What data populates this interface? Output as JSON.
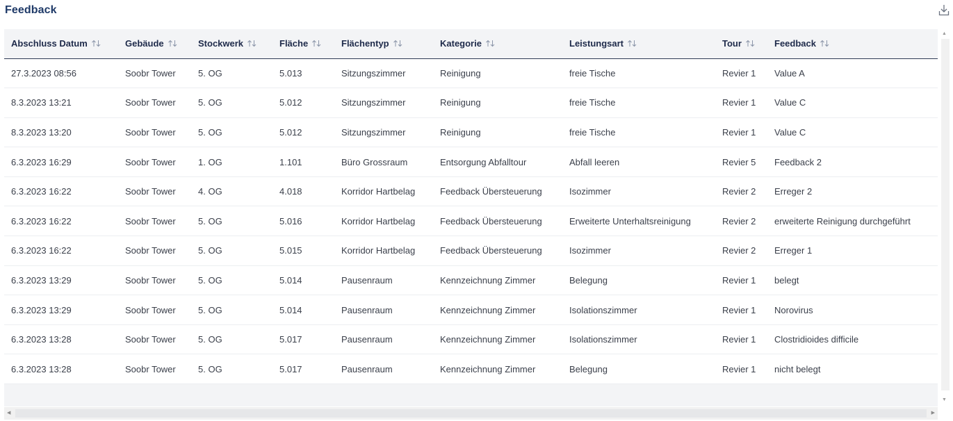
{
  "title": "Feedback",
  "icons": {
    "download": "download-icon",
    "sort": "sort-up-down-icon"
  },
  "columns": [
    {
      "label": "Abschluss Datum"
    },
    {
      "label": "Gebäude"
    },
    {
      "label": "Stockwerk"
    },
    {
      "label": "Fläche"
    },
    {
      "label": "Flächentyp"
    },
    {
      "label": "Kategorie"
    },
    {
      "label": "Leistungsart"
    },
    {
      "label": "Tour"
    },
    {
      "label": "Feedback"
    }
  ],
  "rows": [
    [
      "27.3.2023 08:56",
      "Soobr Tower",
      "5. OG",
      "5.013",
      "Sitzungszimmer",
      "Reinigung",
      "freie Tische",
      "Revier 1",
      "Value A"
    ],
    [
      "8.3.2023 13:21",
      "Soobr Tower",
      "5. OG",
      "5.012",
      "Sitzungszimmer",
      "Reinigung",
      "freie Tische",
      "Revier 1",
      "Value C"
    ],
    [
      "8.3.2023 13:20",
      "Soobr Tower",
      "5. OG",
      "5.012",
      "Sitzungszimmer",
      "Reinigung",
      "freie Tische",
      "Revier 1",
      "Value C"
    ],
    [
      "6.3.2023 16:29",
      "Soobr Tower",
      "1. OG",
      "1.101",
      "Büro Grossraum",
      "Entsorgung Abfalltour",
      "Abfall leeren",
      "Revier 5",
      "Feedback 2"
    ],
    [
      "6.3.2023 16:22",
      "Soobr Tower",
      "4. OG",
      "4.018",
      "Korridor Hartbelag",
      "Feedback Übersteuerung",
      "Isozimmer",
      "Revier 2",
      "Erreger 2"
    ],
    [
      "6.3.2023 16:22",
      "Soobr Tower",
      "5. OG",
      "5.016",
      "Korridor Hartbelag",
      "Feedback Übersteuerung",
      "Erweiterte Unterhaltsreinigung",
      "Revier 2",
      "erweiterte Reinigung durchgeführt"
    ],
    [
      "6.3.2023 16:22",
      "Soobr Tower",
      "5. OG",
      "5.015",
      "Korridor Hartbelag",
      "Feedback Übersteuerung",
      "Isozimmer",
      "Revier 2",
      "Erreger 1"
    ],
    [
      "6.3.2023 13:29",
      "Soobr Tower",
      "5. OG",
      "5.014",
      "Pausenraum",
      "Kennzeichnung Zimmer",
      "Belegung",
      "Revier 1",
      "belegt"
    ],
    [
      "6.3.2023 13:29",
      "Soobr Tower",
      "5. OG",
      "5.014",
      "Pausenraum",
      "Kennzeichnung Zimmer",
      "Isolationszimmer",
      "Revier 1",
      "Norovirus"
    ],
    [
      "6.3.2023 13:28",
      "Soobr Tower",
      "5. OG",
      "5.017",
      "Pausenraum",
      "Kennzeichnung Zimmer",
      "Isolationszimmer",
      "Revier 1",
      "Clostridioides difficile"
    ],
    [
      "6.3.2023 13:28",
      "Soobr Tower",
      "5. OG",
      "5.017",
      "Pausenraum",
      "Kennzeichnung Zimmer",
      "Belegung",
      "Revier 1",
      "nicht belegt"
    ]
  ]
}
